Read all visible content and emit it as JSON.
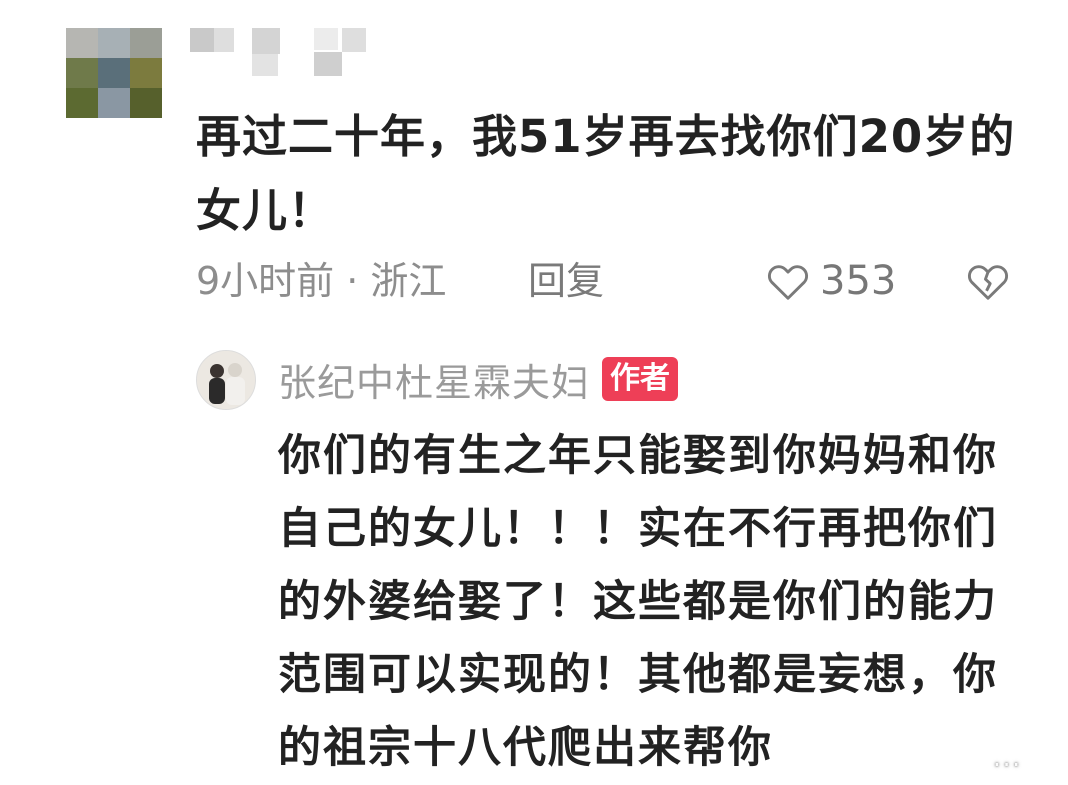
{
  "comment": {
    "text": "再过二十年，我51岁再去找你们20岁的女儿！",
    "time_location": "9小时前 · 浙江",
    "reply_label": "回复",
    "like_count": "353"
  },
  "reply": {
    "author_name": "张纪中杜星霖夫妇",
    "author_badge": "作者",
    "text": "你们的有生之年只能娶到你妈妈和你自己的女儿！！！实在不行再把你们的外婆给娶了！这些都是你们的能力范围可以实现的！其他都是妄想，你的祖宗十八代爬出来帮你"
  },
  "watermark": "...",
  "icons": {
    "like": "heart-outline-icon",
    "dislike": "broken-heart-icon"
  }
}
